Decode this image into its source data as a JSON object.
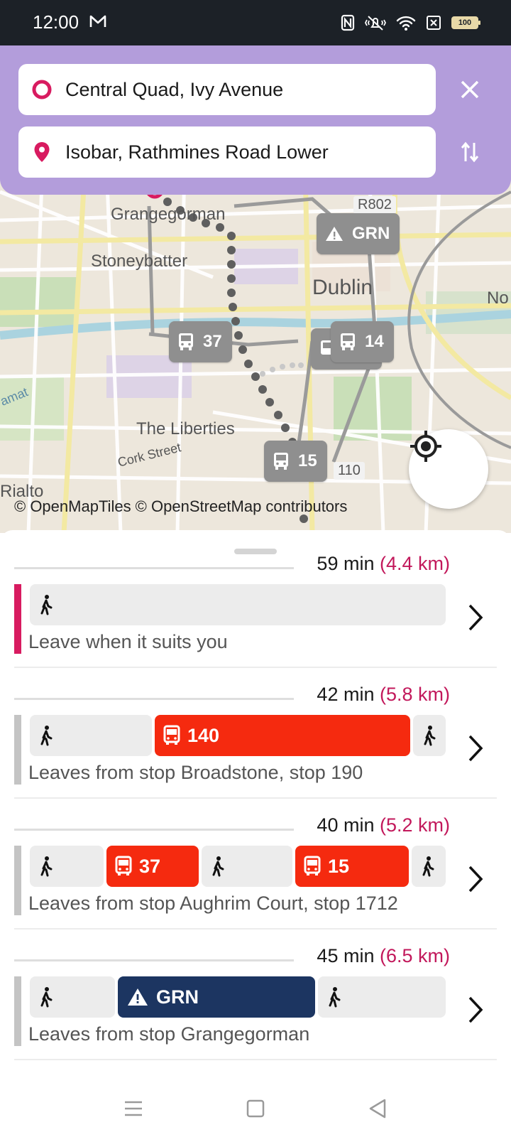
{
  "status_bar": {
    "time": "12:00",
    "icons": [
      "mail-icon",
      "nfc-icon",
      "vibrate-icon",
      "wifi-icon",
      "sim-icon",
      "battery-icon"
    ],
    "battery": "100"
  },
  "search": {
    "from": "Central Quad, Ivy Avenue",
    "to": "Isobar, Rathmines Road Lower",
    "accent_color": "#b39ddb",
    "pin_color": "#d81b60"
  },
  "map": {
    "labels": {
      "grangegorman": "Grangegorman",
      "stoneybatter": "Stoneybatter",
      "dublin": "Dublin",
      "liberties": "The Liberties",
      "cork_street": "Cork Street",
      "r802": "R802",
      "r110": "110",
      "rialto": "Rialto",
      "no": "No",
      "amat": "amat"
    },
    "badges": {
      "grn": "GRN",
      "b37": "37",
      "b14": "14",
      "b15": "15"
    },
    "attribution": "© OpenMapTiles © OpenStreetMap contributors"
  },
  "itineraries": [
    {
      "summary_time": "59 min",
      "summary_dist": "(4.4 km)",
      "description": "Leave when it suits you",
      "bar_color": "#d81b60",
      "legs": [
        {
          "type": "walk",
          "label": ""
        }
      ]
    },
    {
      "summary_time": "42 min",
      "summary_dist": "(5.8 km)",
      "description": "Leaves from stop Broadstone, stop 190",
      "bar_color": "#c4c4c4",
      "legs": [
        {
          "type": "walk",
          "label": ""
        },
        {
          "type": "bus",
          "label": "140"
        },
        {
          "type": "walk",
          "label": ""
        }
      ]
    },
    {
      "summary_time": "40 min",
      "summary_dist": "(5.2 km)",
      "description": "Leaves from stop Aughrim Court, stop 1712",
      "bar_color": "#c4c4c4",
      "legs": [
        {
          "type": "walk",
          "label": ""
        },
        {
          "type": "bus",
          "label": "37"
        },
        {
          "type": "walk",
          "label": ""
        },
        {
          "type": "bus",
          "label": "15"
        },
        {
          "type": "walk",
          "label": ""
        }
      ]
    },
    {
      "summary_time": "45 min",
      "summary_dist": "(6.5 km)",
      "description": "Leaves from stop Grangegorman",
      "bar_color": "#c4c4c4",
      "legs": [
        {
          "type": "walk",
          "label": ""
        },
        {
          "type": "tram",
          "label": "GRN"
        },
        {
          "type": "walk",
          "label": ""
        }
      ]
    }
  ],
  "colors": {
    "bus": "#f52a0f",
    "tram": "#1c3561",
    "walk": "#ececec",
    "distance": "#c2185b"
  }
}
